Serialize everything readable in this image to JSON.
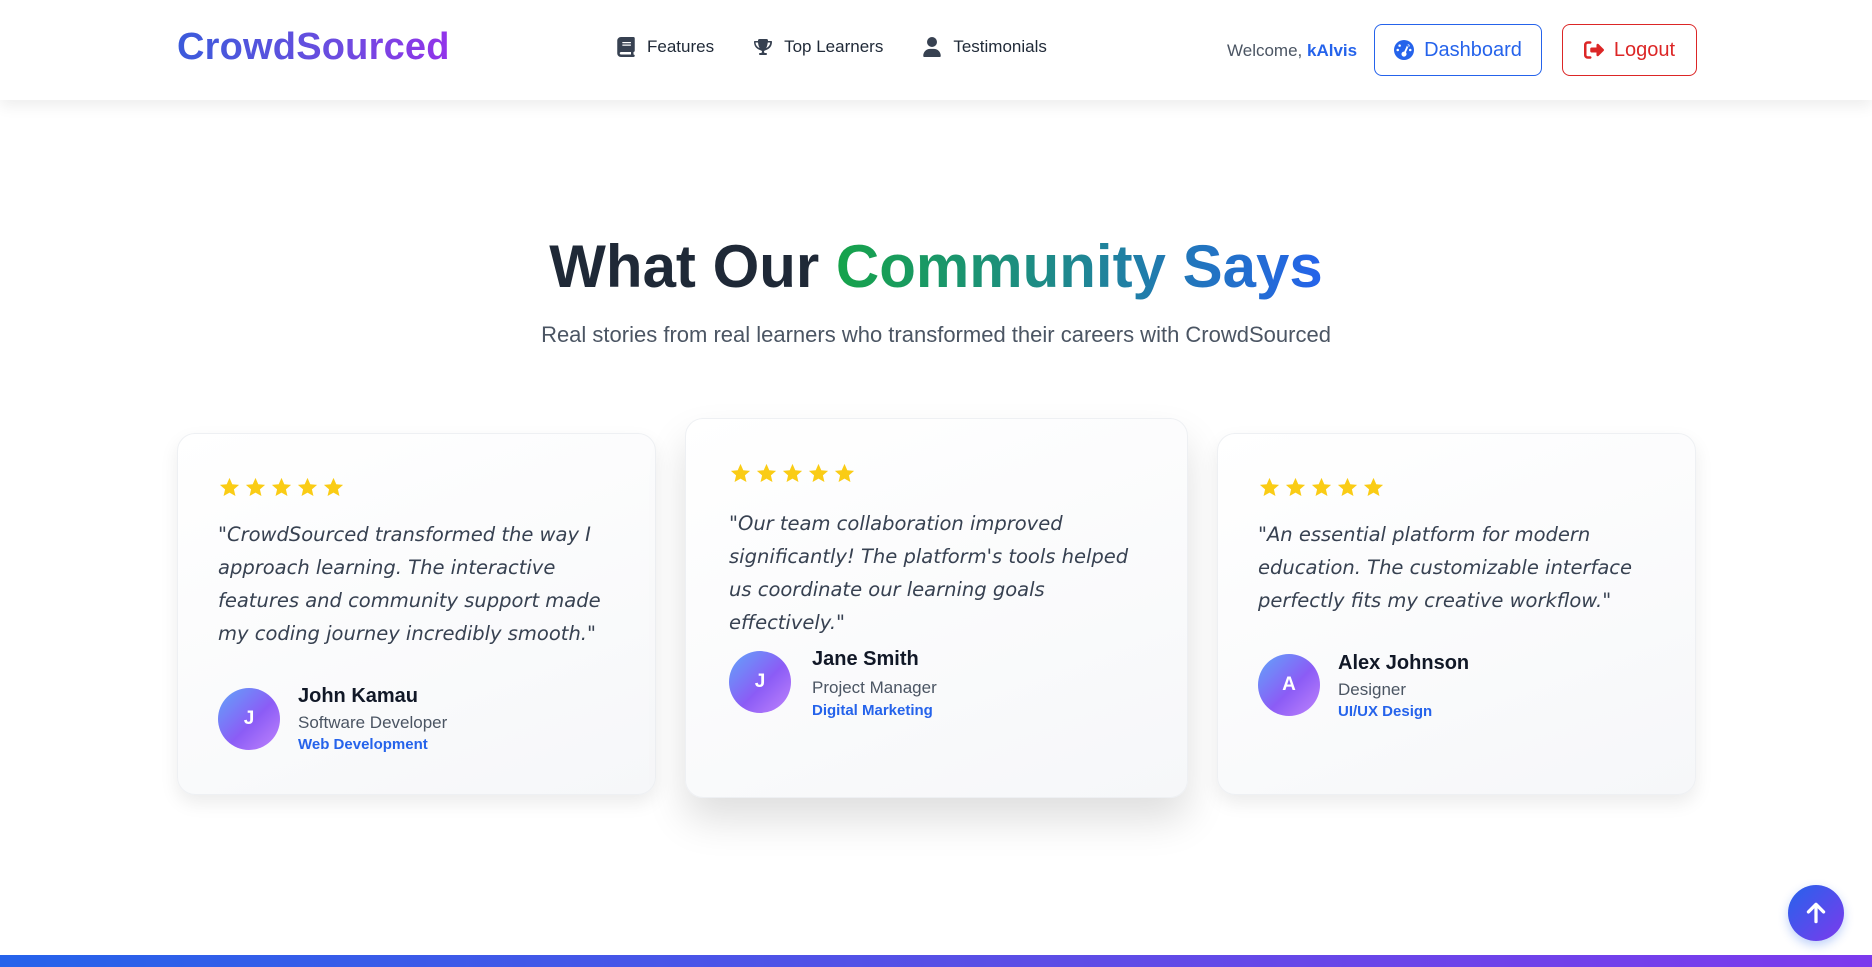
{
  "navbar": {
    "brand": "CrowdSourced",
    "links": [
      {
        "label": "Features",
        "icon": "book-icon"
      },
      {
        "label": "Top Learners",
        "icon": "trophy-icon"
      },
      {
        "label": "Testimonials",
        "icon": "user-icon"
      }
    ],
    "welcome_prefix": "Welcome, ",
    "username": "kAlvis",
    "dashboard_label": "Dashboard",
    "logout_label": "Logout"
  },
  "section": {
    "title_plain": "What Our ",
    "title_highlight": "Community Says",
    "subtitle": "Real stories from real learners who transformed their careers with CrowdSourced"
  },
  "testimonials": [
    {
      "rating": 5,
      "quote": "\"CrowdSourced transformed the way I approach learning. The interactive features and community support made my coding journey incredibly smooth.\"",
      "initial": "J",
      "name": "John Kamau",
      "role": "Software Developer",
      "tag": "Web Development"
    },
    {
      "rating": 5,
      "quote": "\"Our team collaboration improved significantly! The platform's tools helped us coordinate our learning goals effectively.\"",
      "initial": "J",
      "name": "Jane Smith",
      "role": "Project Manager",
      "tag": "Digital Marketing"
    },
    {
      "rating": 5,
      "quote": "\"An essential platform for modern education. The customizable interface perfectly fits my creative workflow.\"",
      "initial": "A",
      "name": "Alex Johnson",
      "role": "Designer",
      "tag": "UI/UX Design"
    }
  ],
  "colors": {
    "accent_blue": "#2563eb",
    "accent_purple": "#7c3aed",
    "danger": "#dc2626",
    "star": "#facc15"
  },
  "scroll_top_icon": "arrow-up-icon"
}
